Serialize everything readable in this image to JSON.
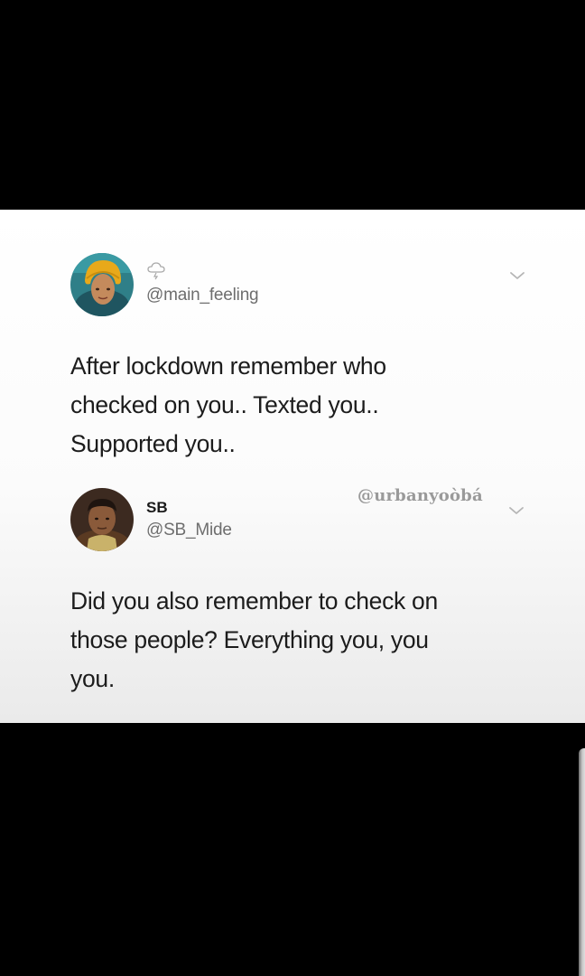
{
  "tweet_1": {
    "handle": "@main_feeling",
    "text": "After lockdown remember who\nchecked on you.. Texted you..\nSupported you..",
    "status_icon": "cloud-lightning-icon"
  },
  "tweet_2": {
    "name": "SB",
    "handle": "@SB_Mide",
    "text": "Did you also remember to check on\nthose people? Everything you, you\nyou."
  },
  "watermark": "@urbanyoòbá",
  "colors": {
    "background": "#000000",
    "card": "#ffffff",
    "text": "#1c1c1c",
    "secondary_text": "#6e6e6e",
    "watermark": "#9a9a9a"
  }
}
